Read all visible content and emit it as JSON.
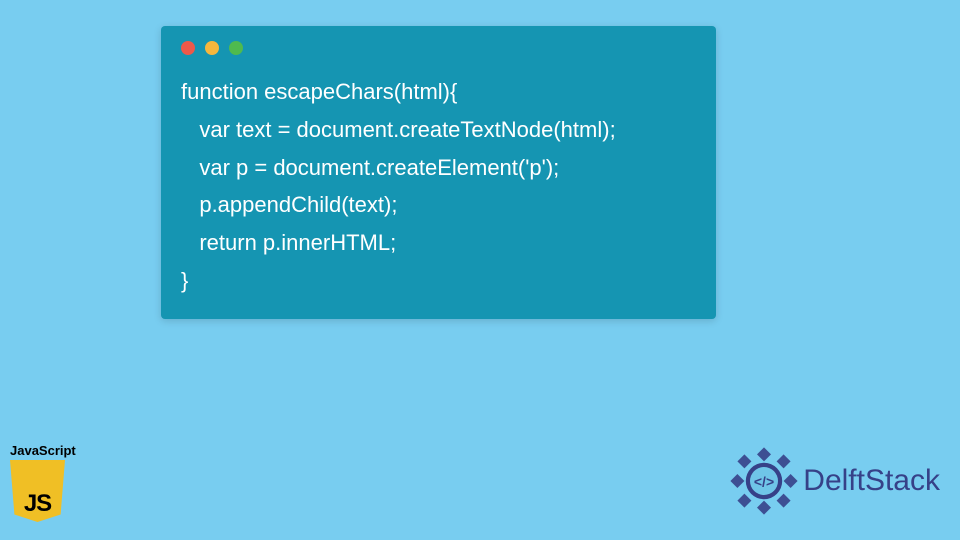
{
  "code": {
    "lines": [
      "function escapeChars(html){",
      "   var text = document.createTextNode(html);",
      "   var p = document.createElement('p');",
      "   p.appendChild(text);",
      "   return p.innerHTML;",
      "}"
    ]
  },
  "jsBadge": {
    "label": "JavaScript",
    "logoText": "JS"
  },
  "brand": {
    "name": "DelftStack",
    "iconColor": "#364188"
  },
  "colors": {
    "pageBg": "#78cdf0",
    "windowBg": "#1595b2",
    "codeText": "#ffffff"
  }
}
